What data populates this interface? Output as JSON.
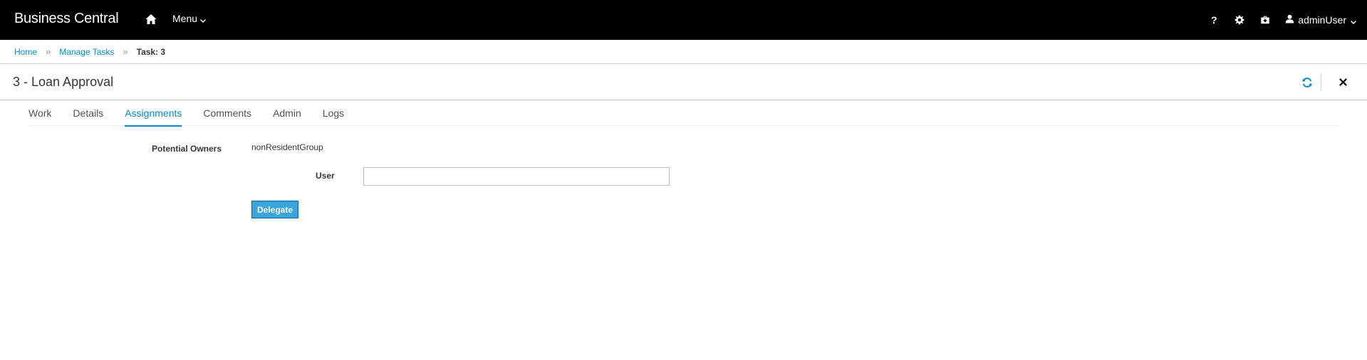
{
  "navbar": {
    "brand": "Business Central",
    "menu_label": "Menu",
    "help_label": "?",
    "user_name": "adminUser"
  },
  "breadcrumb": {
    "home": "Home",
    "manage_tasks": "Manage Tasks",
    "current": "Task: 3",
    "separator": "»"
  },
  "title": {
    "text": "3 - Loan Approval"
  },
  "tabs": [
    {
      "label": "Work"
    },
    {
      "label": "Details"
    },
    {
      "label": "Assignments"
    },
    {
      "label": "Comments"
    },
    {
      "label": "Admin"
    },
    {
      "label": "Logs"
    }
  ],
  "active_tab": "Assignments",
  "assignments": {
    "owners_label": "Potential Owners",
    "owners_value": "nonResidentGroup",
    "user_label": "User",
    "user_value": "",
    "delegate_label": "Delegate"
  },
  "colors": {
    "navbar_bg": "#000000",
    "link": "#0088ce",
    "button_bg": "#39a5dc"
  }
}
